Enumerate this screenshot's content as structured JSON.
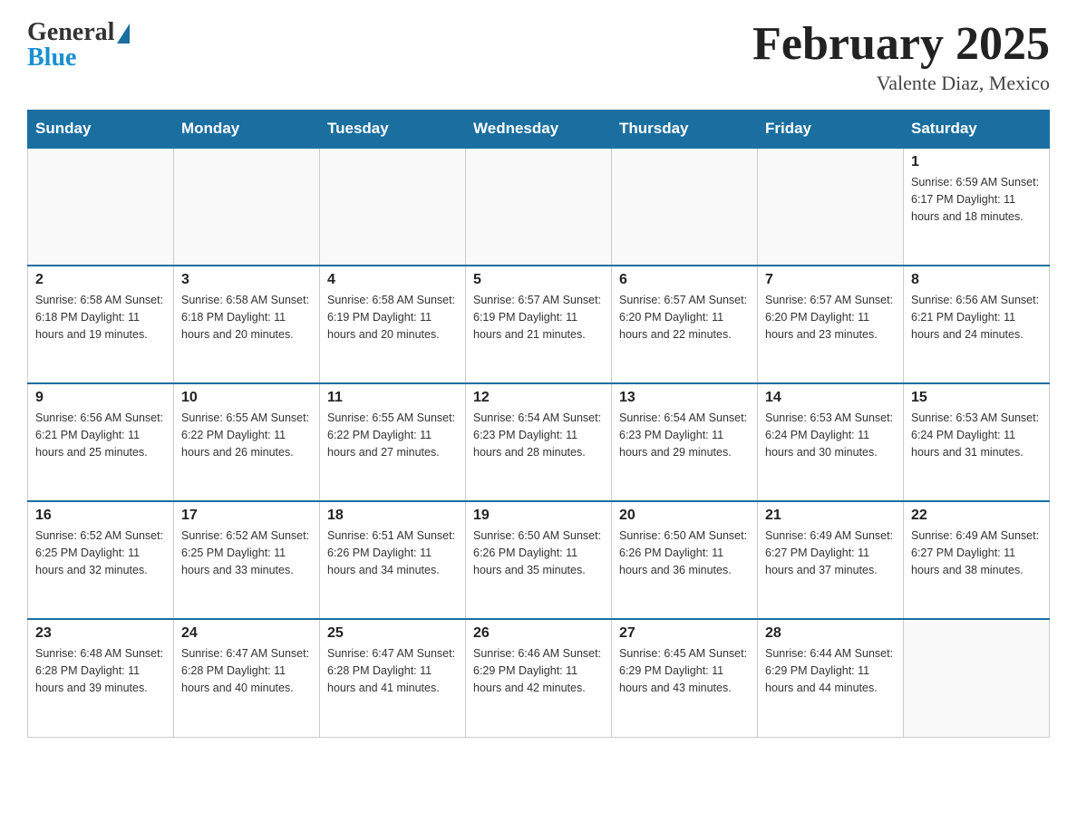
{
  "header": {
    "logo_general": "General",
    "logo_blue": "Blue",
    "month_title": "February 2025",
    "location": "Valente Diaz, Mexico"
  },
  "days_of_week": [
    "Sunday",
    "Monday",
    "Tuesday",
    "Wednesday",
    "Thursday",
    "Friday",
    "Saturday"
  ],
  "weeks": [
    [
      {
        "day": "",
        "info": ""
      },
      {
        "day": "",
        "info": ""
      },
      {
        "day": "",
        "info": ""
      },
      {
        "day": "",
        "info": ""
      },
      {
        "day": "",
        "info": ""
      },
      {
        "day": "",
        "info": ""
      },
      {
        "day": "1",
        "info": "Sunrise: 6:59 AM\nSunset: 6:17 PM\nDaylight: 11 hours and 18 minutes."
      }
    ],
    [
      {
        "day": "2",
        "info": "Sunrise: 6:58 AM\nSunset: 6:18 PM\nDaylight: 11 hours and 19 minutes."
      },
      {
        "day": "3",
        "info": "Sunrise: 6:58 AM\nSunset: 6:18 PM\nDaylight: 11 hours and 20 minutes."
      },
      {
        "day": "4",
        "info": "Sunrise: 6:58 AM\nSunset: 6:19 PM\nDaylight: 11 hours and 20 minutes."
      },
      {
        "day": "5",
        "info": "Sunrise: 6:57 AM\nSunset: 6:19 PM\nDaylight: 11 hours and 21 minutes."
      },
      {
        "day": "6",
        "info": "Sunrise: 6:57 AM\nSunset: 6:20 PM\nDaylight: 11 hours and 22 minutes."
      },
      {
        "day": "7",
        "info": "Sunrise: 6:57 AM\nSunset: 6:20 PM\nDaylight: 11 hours and 23 minutes."
      },
      {
        "day": "8",
        "info": "Sunrise: 6:56 AM\nSunset: 6:21 PM\nDaylight: 11 hours and 24 minutes."
      }
    ],
    [
      {
        "day": "9",
        "info": "Sunrise: 6:56 AM\nSunset: 6:21 PM\nDaylight: 11 hours and 25 minutes."
      },
      {
        "day": "10",
        "info": "Sunrise: 6:55 AM\nSunset: 6:22 PM\nDaylight: 11 hours and 26 minutes."
      },
      {
        "day": "11",
        "info": "Sunrise: 6:55 AM\nSunset: 6:22 PM\nDaylight: 11 hours and 27 minutes."
      },
      {
        "day": "12",
        "info": "Sunrise: 6:54 AM\nSunset: 6:23 PM\nDaylight: 11 hours and 28 minutes."
      },
      {
        "day": "13",
        "info": "Sunrise: 6:54 AM\nSunset: 6:23 PM\nDaylight: 11 hours and 29 minutes."
      },
      {
        "day": "14",
        "info": "Sunrise: 6:53 AM\nSunset: 6:24 PM\nDaylight: 11 hours and 30 minutes."
      },
      {
        "day": "15",
        "info": "Sunrise: 6:53 AM\nSunset: 6:24 PM\nDaylight: 11 hours and 31 minutes."
      }
    ],
    [
      {
        "day": "16",
        "info": "Sunrise: 6:52 AM\nSunset: 6:25 PM\nDaylight: 11 hours and 32 minutes."
      },
      {
        "day": "17",
        "info": "Sunrise: 6:52 AM\nSunset: 6:25 PM\nDaylight: 11 hours and 33 minutes."
      },
      {
        "day": "18",
        "info": "Sunrise: 6:51 AM\nSunset: 6:26 PM\nDaylight: 11 hours and 34 minutes."
      },
      {
        "day": "19",
        "info": "Sunrise: 6:50 AM\nSunset: 6:26 PM\nDaylight: 11 hours and 35 minutes."
      },
      {
        "day": "20",
        "info": "Sunrise: 6:50 AM\nSunset: 6:26 PM\nDaylight: 11 hours and 36 minutes."
      },
      {
        "day": "21",
        "info": "Sunrise: 6:49 AM\nSunset: 6:27 PM\nDaylight: 11 hours and 37 minutes."
      },
      {
        "day": "22",
        "info": "Sunrise: 6:49 AM\nSunset: 6:27 PM\nDaylight: 11 hours and 38 minutes."
      }
    ],
    [
      {
        "day": "23",
        "info": "Sunrise: 6:48 AM\nSunset: 6:28 PM\nDaylight: 11 hours and 39 minutes."
      },
      {
        "day": "24",
        "info": "Sunrise: 6:47 AM\nSunset: 6:28 PM\nDaylight: 11 hours and 40 minutes."
      },
      {
        "day": "25",
        "info": "Sunrise: 6:47 AM\nSunset: 6:28 PM\nDaylight: 11 hours and 41 minutes."
      },
      {
        "day": "26",
        "info": "Sunrise: 6:46 AM\nSunset: 6:29 PM\nDaylight: 11 hours and 42 minutes."
      },
      {
        "day": "27",
        "info": "Sunrise: 6:45 AM\nSunset: 6:29 PM\nDaylight: 11 hours and 43 minutes."
      },
      {
        "day": "28",
        "info": "Sunrise: 6:44 AM\nSunset: 6:29 PM\nDaylight: 11 hours and 44 minutes."
      },
      {
        "day": "",
        "info": ""
      }
    ]
  ]
}
